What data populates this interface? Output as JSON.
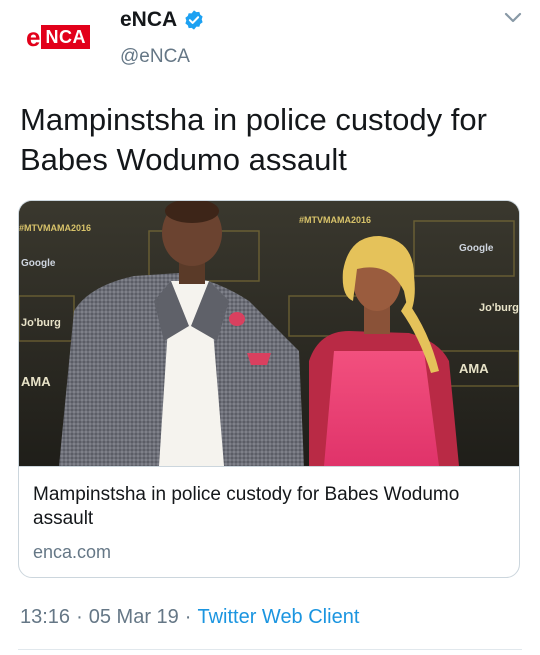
{
  "account": {
    "display_name": "eNCA",
    "handle": "@eNCA",
    "logo_letter": "e",
    "logo_text": "NCA",
    "verified": true
  },
  "tweet": {
    "text": "Mampinstsha in police custody for Babes Wodumo assault"
  },
  "card": {
    "title": "Mampinstsha in police custody for Babes Wodumo assault",
    "domain": "enca.com",
    "image_backdrop_texts": [
      "#MTVMAMA2016",
      "Google",
      "Jo'burg",
      "AMA",
      "#MTVMAMA2016",
      "Google",
      "Jo'burg",
      "AMA"
    ]
  },
  "meta": {
    "time": "13:16",
    "date": "05 Mar 19",
    "separator": "·",
    "client": "Twitter Web Client"
  },
  "colors": {
    "brand_red": "#e2001a",
    "verified_blue": "#1da1f2",
    "link_blue": "#1b95e0",
    "muted": "#657786"
  },
  "icons": {
    "verified": "verified-badge-icon",
    "menu": "chevron-down-icon"
  }
}
